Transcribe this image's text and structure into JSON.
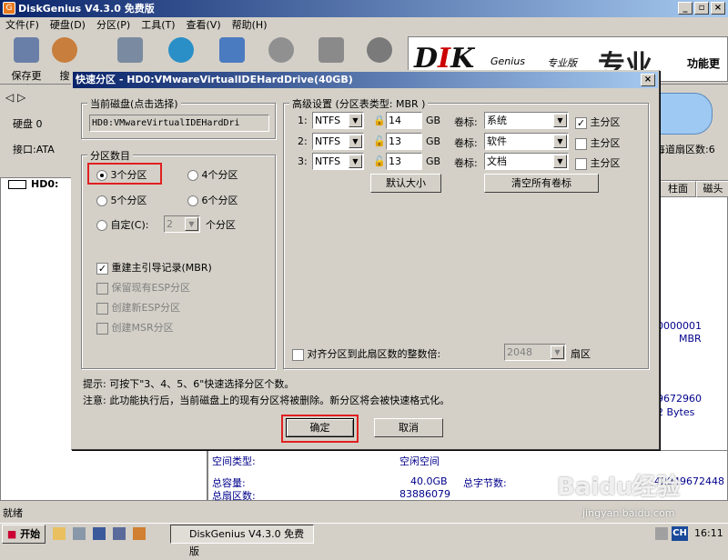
{
  "window": {
    "title": "DiskGenius V4.3.0 免费版"
  },
  "menu": [
    "文件(F)",
    "硬盘(D)",
    "分区(P)",
    "工具(T)",
    "查看(V)",
    "帮助(H)"
  ],
  "toolbar": {
    "save": "保存更改",
    "search": "搜"
  },
  "brand": {
    "logo_prefix": "D",
    "logo_mid": "I",
    "logo_k": "K",
    "logo_suffix": "Genius",
    "pro": "专业版",
    "cn": "专业",
    "func": "功能更"
  },
  "left": {
    "disk": "硬盘 0",
    "iface": "接口:ATA",
    "tree_item": "HD0:"
  },
  "right": {
    "sectors_per_track": "每道扇区数:6",
    "col_cyl": "柱面",
    "col_head": "磁头",
    "val1": "0000001",
    "val2": "MBR",
    "val3": "9672960",
    "val4": "2 Bytes"
  },
  "bottom": {
    "space_type_label": "空间类型:",
    "space_type_value": "空闲空间",
    "total_cap_label": "总容量:",
    "total_cap_value": "40.0GB",
    "total_bytes_label": "总字节数:",
    "total_bytes_value": "42949672448",
    "total_sectors_label": "总扇区数:",
    "total_sectors_value": "83886079"
  },
  "status": "就绪",
  "dialog": {
    "title": "快速分区 - HD0:VMwareVirtualIDEHardDrive(40GB)",
    "current_disk_label": "当前磁盘(点击选择)",
    "current_disk_value": "HD0:VMwareVirtualIDEHardDri",
    "count_group": "分区数目",
    "opt3": "3个分区",
    "opt4": "4个分区",
    "opt5": "5个分区",
    "opt6": "6个分区",
    "custom": "自定(C):",
    "custom_value": "2",
    "custom_unit": "个分区",
    "rebuild_mbr": "重建主引导记录(MBR)",
    "keep_esp": "保留现有ESP分区",
    "create_esp": "创建新ESP分区",
    "create_msr": "创建MSR分区",
    "advanced": "高级设置 (分区表类型: MBR )",
    "rows": [
      {
        "idx": "1:",
        "fs": "NTFS",
        "size": "14",
        "unit": "GB",
        "vol_label": "卷标:",
        "vol": "系统",
        "primary": "主分区",
        "checked": true
      },
      {
        "idx": "2:",
        "fs": "NTFS",
        "size": "13",
        "unit": "GB",
        "vol_label": "卷标:",
        "vol": "软件",
        "primary": "主分区",
        "checked": false
      },
      {
        "idx": "3:",
        "fs": "NTFS",
        "size": "13",
        "unit": "GB",
        "vol_label": "卷标:",
        "vol": "文档",
        "primary": "主分区",
        "checked": false
      }
    ],
    "default_size": "默认大小",
    "clear_labels": "清空所有卷标",
    "align_label": "对齐分区到此扇区数的整数倍:",
    "align_value": "2048",
    "align_unit": "扇区",
    "hint": "提示: 可按下\"3、4、5、6\"快速选择分区个数。",
    "note": "注意: 此功能执行后，当前磁盘上的现有分区将被删除。新分区将会被快速格式化。",
    "ok": "确定",
    "cancel": "取消"
  },
  "taskbar": {
    "start": "开始",
    "task": "DiskGenius V4.3.0 免费版",
    "lang": "CH",
    "time": "16:11"
  },
  "watermark": {
    "text": "Baidu经验",
    "url": "jingyan.baidu.com"
  },
  "colors": {
    "titlebar": "#0a246a",
    "highlight": "#e02020"
  }
}
